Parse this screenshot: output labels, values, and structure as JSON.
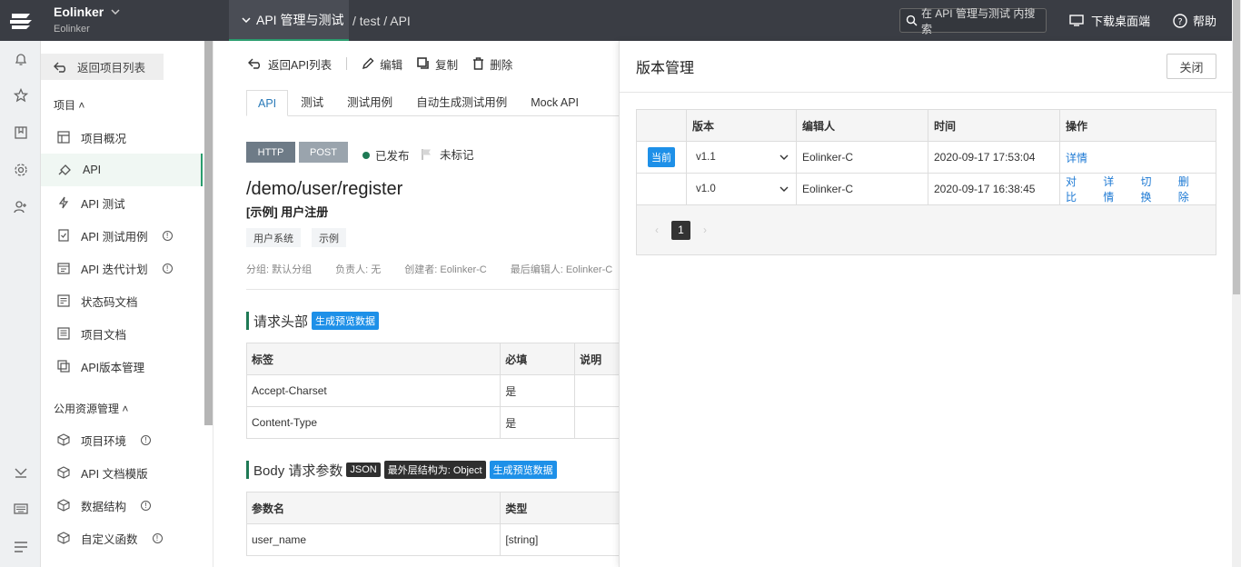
{
  "topbar": {
    "brand_name": "Eolinker",
    "brand_sub": "Eolinker",
    "project_tab": "API 管理与测试",
    "breadcrumb": "/ test / API",
    "search_placeholder": "在 API 管理与测试 内搜索",
    "download_label": "下载桌面端",
    "help_label": "帮助"
  },
  "sidebar": {
    "back_label": "返回项目列表",
    "section_project": "项目",
    "section_public": "公用资源管理",
    "items": [
      {
        "label": "项目概况",
        "icon": "dashboard-icon"
      },
      {
        "label": "API",
        "icon": "plug-icon"
      },
      {
        "label": "API 测试",
        "icon": "bolt-icon"
      },
      {
        "label": "API 测试用例",
        "icon": "checklist-icon"
      },
      {
        "label": "API 迭代计划",
        "icon": "calendar-icon"
      },
      {
        "label": "状态码文档",
        "icon": "code-doc-icon"
      },
      {
        "label": "项目文档",
        "icon": "doc-icon"
      },
      {
        "label": "API版本管理",
        "icon": "versions-icon"
      }
    ],
    "public_items": [
      {
        "label": "项目环境",
        "icon": "cube-icon"
      },
      {
        "label": "API 文档模版",
        "icon": "cube-icon"
      },
      {
        "label": "数据结构",
        "icon": "cube-icon"
      },
      {
        "label": "自定义函数",
        "icon": "cube-icon"
      }
    ]
  },
  "toolbar": {
    "back": "返回API列表",
    "edit": "编辑",
    "copy": "复制",
    "delete": "删除"
  },
  "tabs": [
    "API",
    "测试",
    "测试用例",
    "自动生成测试用例",
    "Mock API"
  ],
  "api": {
    "protocol": "HTTP",
    "method": "POST",
    "status": "已发布",
    "mark": "未标记",
    "path": "/demo/user/register",
    "name": "[示例] 用户注册",
    "tags": [
      "用户系统",
      "示例"
    ],
    "meta": [
      "分组: 默认分组",
      "负责人: 无",
      "创建者: Eolinker-C",
      "最后编辑人: Eolinker-C"
    ]
  },
  "header_section": {
    "title": "请求头部",
    "chip": "生成预览数据",
    "columns": [
      "标签",
      "必填",
      "说明"
    ],
    "rows": [
      [
        "Accept-Charset",
        "是",
        ""
      ],
      [
        "Content-Type",
        "是",
        ""
      ]
    ]
  },
  "body_section": {
    "title": "Body 请求参数",
    "chip_json": "JSON",
    "chip_struct": "最外层结构为: Object",
    "chip_preview": "生成预览数据",
    "columns": [
      "参数名",
      "类型"
    ],
    "rows": [
      [
        "user_name",
        "[string]"
      ]
    ]
  },
  "version_panel": {
    "title": "版本管理",
    "close": "关闭",
    "columns": [
      "",
      "版本",
      "编辑人",
      "时间",
      "操作"
    ],
    "rows": [
      {
        "current": "当前",
        "version": "v1.1",
        "editor": "Eolinker-C",
        "time": "2020-09-17 17:53:04",
        "actions": [
          "详情"
        ]
      },
      {
        "current": "",
        "version": "v1.0",
        "editor": "Eolinker-C",
        "time": "2020-09-17 16:38:45",
        "actions": [
          "对比",
          "详情",
          "切换",
          "删除"
        ]
      }
    ],
    "page": "1"
  },
  "colors": {
    "topbar": "#3a3d44",
    "accent_green": "#1f7a55",
    "link_blue": "#1e7ad4",
    "badge_blue": "#1e90e8"
  }
}
